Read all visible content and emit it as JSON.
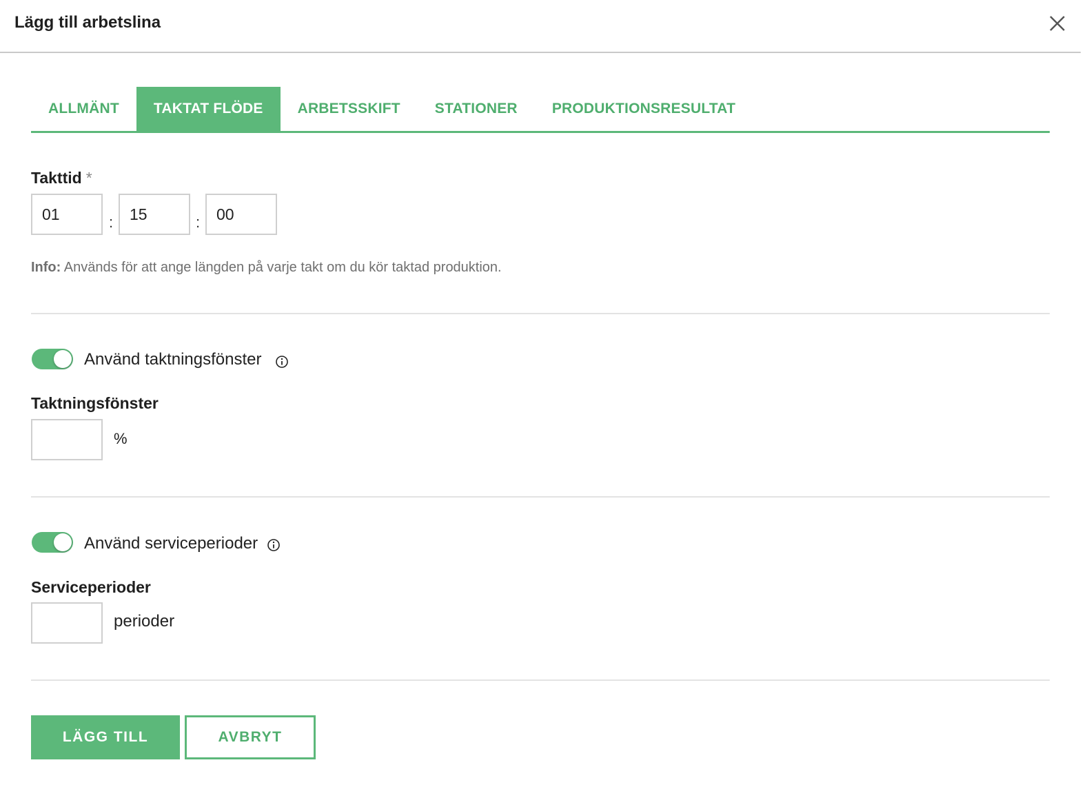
{
  "dialog": {
    "title": "Lägg till arbetslina",
    "close_icon": "close-icon"
  },
  "tabs": [
    {
      "label": "ALLMÄNT",
      "active": false
    },
    {
      "label": "TAKTAT FLÖDE",
      "active": true
    },
    {
      "label": "ARBETSSKIFT",
      "active": false
    },
    {
      "label": "STATIONER",
      "active": false
    },
    {
      "label": "PRODUKTIONSRESULTAT",
      "active": false
    }
  ],
  "takttid": {
    "label": "Takttid",
    "required_marker": "*",
    "hours": "01",
    "minutes": "15",
    "seconds": "00",
    "separator": ":",
    "info_prefix": "Info:",
    "info_text": " Används för att ange längden på varje takt om du kör taktad produktion."
  },
  "taktningsfonster": {
    "toggle_label": "Använd taktningsfönster",
    "toggle_on": true,
    "label": "Taktningsfönster",
    "value": "",
    "unit": "%"
  },
  "serviceperioder": {
    "toggle_label": "Använd serviceperioder",
    "toggle_on": true,
    "label": "Serviceperioder",
    "value": "",
    "unit": "perioder"
  },
  "buttons": {
    "add": "LÄGG TILL",
    "cancel": "AVBRYT"
  },
  "colors": {
    "accent": "#5cb87a",
    "accent_text": "#4fae6e"
  }
}
